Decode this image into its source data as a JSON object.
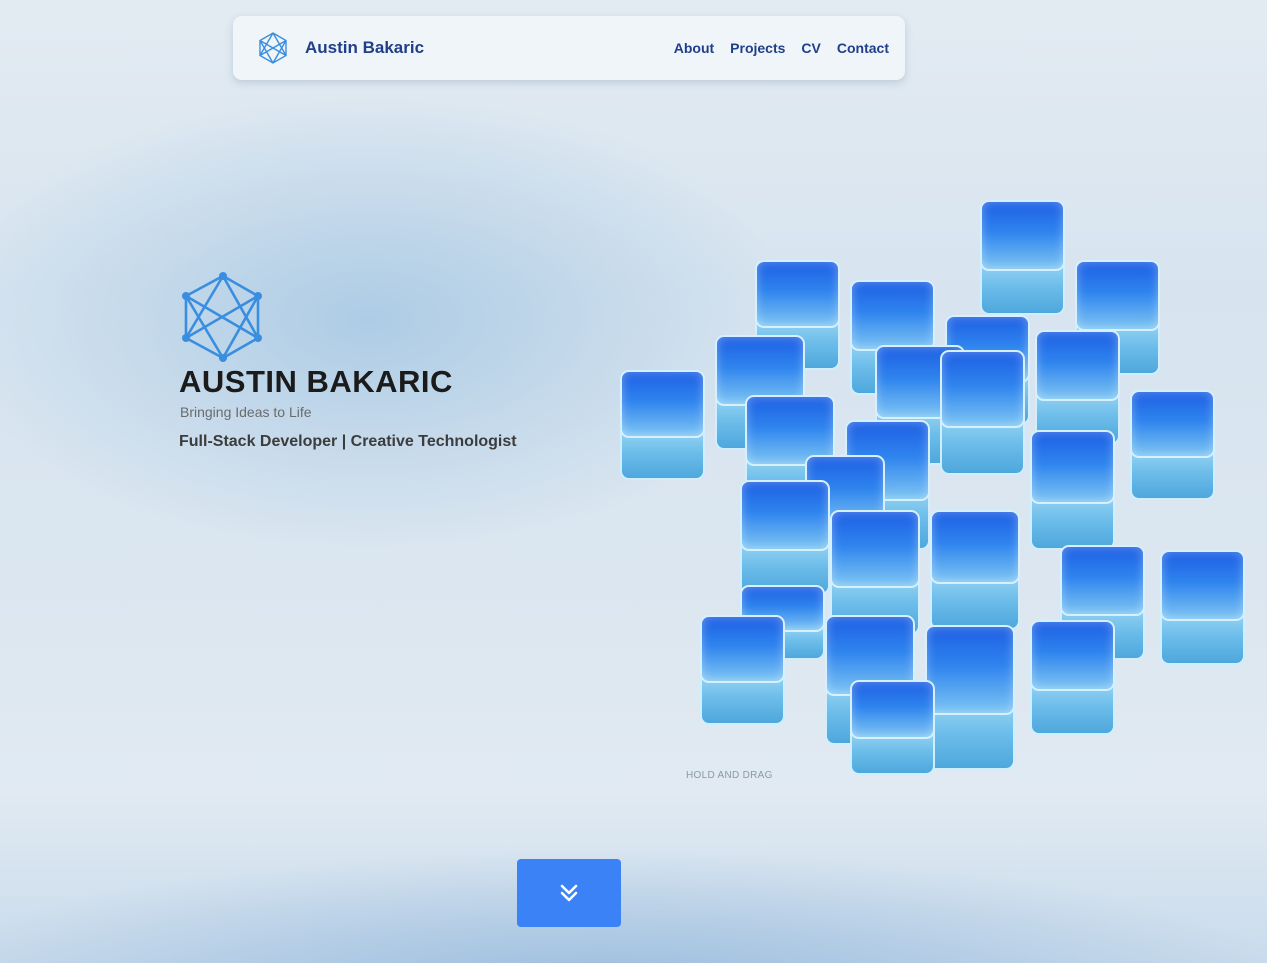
{
  "nav": {
    "brand": "Austin Bakaric",
    "logo_icon": "network-hexagon-icon",
    "links": [
      "About",
      "Projects",
      "CV",
      "Contact"
    ]
  },
  "hero": {
    "logo_icon": "network-hexagon-icon",
    "title": "AUSTIN BAKARIC",
    "tagline": "Bringing Ideas to Life",
    "role": "Full-Stack Developer | Creative Technologist"
  },
  "scene": {
    "hint": "HOLD  AND DRAG",
    "object": "blue-glass-cube-cluster"
  },
  "scroll_button": {
    "icon": "chevrons-down-icon"
  },
  "colors": {
    "brand": "#1f3f8a",
    "accent": "#3b82f6",
    "cube_blue": "#2f7dee",
    "logo_blue": "#3a8ee0"
  }
}
